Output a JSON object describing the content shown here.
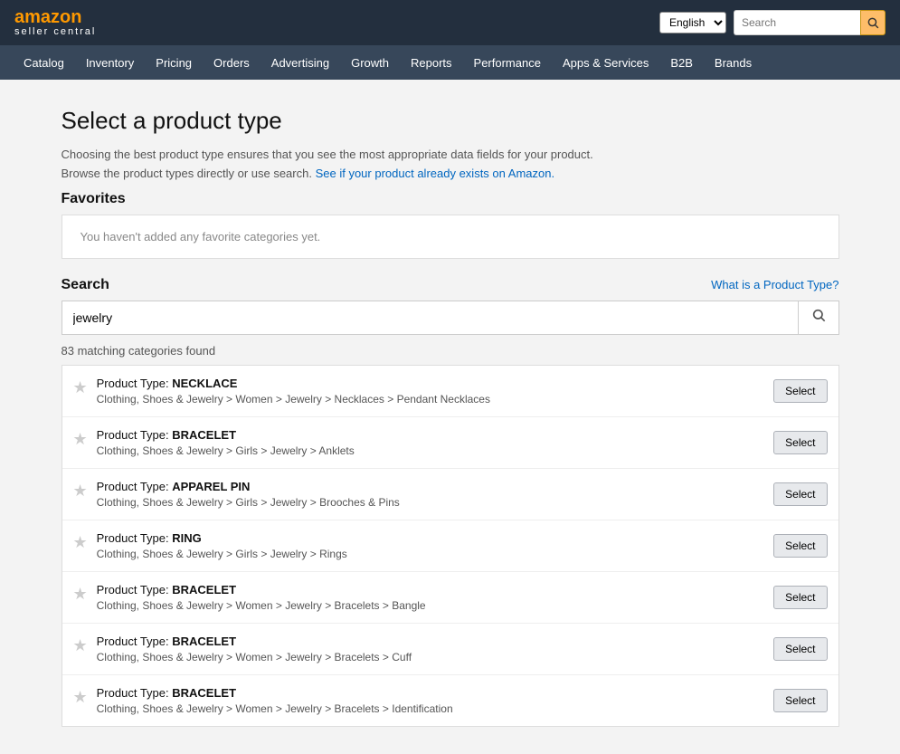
{
  "header": {
    "logo_text": "amazon",
    "logo_sub": "seller central",
    "lang_selected": "English",
    "search_placeholder": "Search"
  },
  "nav": {
    "items": [
      {
        "label": "Catalog",
        "active": false
      },
      {
        "label": "Inventory",
        "active": false
      },
      {
        "label": "Pricing",
        "active": false
      },
      {
        "label": "Orders",
        "active": false
      },
      {
        "label": "Advertising",
        "active": false
      },
      {
        "label": "Growth",
        "active": false
      },
      {
        "label": "Reports",
        "active": false
      },
      {
        "label": "Performance",
        "active": false
      },
      {
        "label": "Apps & Services",
        "active": false
      },
      {
        "label": "B2B",
        "active": false
      },
      {
        "label": "Brands",
        "active": false
      }
    ]
  },
  "page": {
    "title": "Select a product type",
    "description_line1": "Choosing the best product type ensures that you see the most appropriate data fields for your product.",
    "description_line2": "Browse the product types directly or use search.",
    "description_link": "See if your product already exists on Amazon.",
    "favorites_label": "Favorites",
    "favorites_empty": "You haven't added any favorite categories yet.",
    "search_label": "Search",
    "what_is_link": "What is a Product Type?",
    "search_value": "jewelry",
    "results_count": "83 matching categories found",
    "results": [
      {
        "type_label": "Product Type: ",
        "type_name": "NECKLACE",
        "path": "Clothing, Shoes & Jewelry > Women > Jewelry > Necklaces > Pendant Necklaces",
        "button": "Select"
      },
      {
        "type_label": "Product Type: ",
        "type_name": "BRACELET",
        "path": "Clothing, Shoes & Jewelry > Girls > Jewelry > Anklets",
        "button": "Select"
      },
      {
        "type_label": "Product Type: ",
        "type_name": "APPAREL PIN",
        "path": "Clothing, Shoes & Jewelry > Girls > Jewelry > Brooches & Pins",
        "button": "Select"
      },
      {
        "type_label": "Product Type: ",
        "type_name": "RING",
        "path": "Clothing, Shoes & Jewelry > Girls > Jewelry > Rings",
        "button": "Select"
      },
      {
        "type_label": "Product Type: ",
        "type_name": "BRACELET",
        "path": "Clothing, Shoes & Jewelry > Women > Jewelry > Bracelets > Bangle",
        "button": "Select"
      },
      {
        "type_label": "Product Type: ",
        "type_name": "BRACELET",
        "path": "Clothing, Shoes & Jewelry > Women > Jewelry > Bracelets > Cuff",
        "button": "Select"
      },
      {
        "type_label": "Product Type: ",
        "type_name": "BRACELET",
        "path": "Clothing, Shoes & Jewelry > Women > Jewelry > Bracelets > Identification",
        "button": "Select"
      }
    ]
  }
}
